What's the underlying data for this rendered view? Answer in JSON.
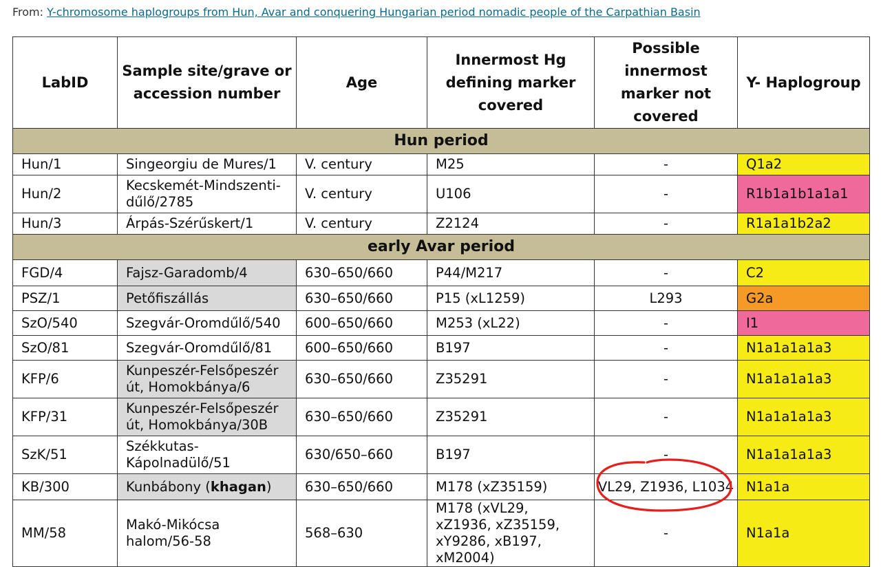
{
  "header": {
    "from_label": "From: ",
    "link_text": "Y-chromosome haplogroups from Hun, Avar and conquering Hungarian period nomadic people of the Carpathian Basin"
  },
  "columns": [
    "LabID",
    "Sample site/grave or accession number",
    "Age",
    "Innermost Hg defining marker covered",
    "Possible innermost marker not covered",
    "Y- Haplogroup"
  ],
  "sections": [
    {
      "title": "Hun period",
      "rows": [
        {
          "labid": "Hun/1",
          "site": "Singeorgiu de Mures/1",
          "age": "V. century",
          "marker": "M25",
          "not_covered": "-",
          "hg": "Q1a2",
          "hg_color": "#f6eb14",
          "site_gray": false
        },
        {
          "labid": "Hun/2",
          "site": "Kecskemét-Mindszenti-dűlő/2785",
          "age": "V. century",
          "marker": "U106",
          "not_covered": "-",
          "hg": "R1b1a1b1a1a1",
          "hg_color": "#ef6a9a",
          "site_gray": false
        },
        {
          "labid": "Hun/3",
          "site": "Árpás-Szérűskert/1",
          "age": "V. century",
          "marker": "Z2124",
          "not_covered": "-",
          "hg": "R1a1a1b2a2",
          "hg_color": "#f6eb14",
          "site_gray": false
        }
      ]
    },
    {
      "title": "early Avar period",
      "rows": [
        {
          "labid": "FGD/4",
          "site": "Fajsz-Garadomb/4",
          "age": "630–650/660",
          "marker": "P44/M217",
          "not_covered": "-",
          "hg": "C2",
          "hg_color": "#f6eb14",
          "site_gray": true
        },
        {
          "labid": "PSZ/1",
          "site": "Petőfiszállás",
          "age": "630–650/660",
          "marker": "P15 (xL1259)",
          "not_covered": "L293",
          "hg": "G2a",
          "hg_color": "#f59a26",
          "site_gray": true
        },
        {
          "labid": "SzO/540",
          "site": "Szegvár-Oromdűlő/540",
          "age": "600–650/660",
          "marker": "M253 (xL22)",
          "not_covered": "-",
          "hg": "I1",
          "hg_color": "#ef6a9a",
          "site_gray": false
        },
        {
          "labid": "SzO/81",
          "site": "Szegvár-Oromdűlő/81",
          "age": "600–650/660",
          "marker": "B197",
          "not_covered": "-",
          "hg": "N1a1a1a1a3",
          "hg_color": "#f6eb14",
          "site_gray": false
        },
        {
          "labid": "KFP/6",
          "site": "Kunpeszér-Felsőpeszér út, Homokbánya/6",
          "age": "630–650/660",
          "marker": "Z35291",
          "not_covered": "-",
          "hg": "N1a1a1a1a3",
          "hg_color": "#f6eb14",
          "site_gray": true
        },
        {
          "labid": "KFP/31",
          "site": "Kunpeszér-Felsőpeszér út, Homokbánya/30B",
          "age": "630–650/660",
          "marker": "Z35291",
          "not_covered": "-",
          "hg": "N1a1a1a1a3",
          "hg_color": "#f6eb14",
          "site_gray": true
        },
        {
          "labid": "SzK/51",
          "site": "Székkutas-Kápolnadülő/51",
          "age": "630/650–660",
          "marker": "B197",
          "not_covered": "-",
          "hg": "N1a1a1a1a3",
          "hg_color": "#f6eb14",
          "site_gray": false
        },
        {
          "labid": "KB/300",
          "site": "Kunbábony (khagan)",
          "site_prefix": "Kunbábony (",
          "site_bold": "khagan",
          "site_suffix": ")",
          "age": "630–650/660",
          "marker": "M178 (xZ35159)",
          "not_covered": "VL29, Z1936, L1034",
          "hg": "N1a1a",
          "hg_color": "#f6eb14",
          "site_gray": true
        },
        {
          "labid": "MM/58",
          "site": "Makó-Mikócsa halom/56-58",
          "age": "568–630",
          "marker": "M178 (xVL29, xZ1936, xZ35159, xY9286, xB197, xM2004)",
          "not_covered": "-",
          "hg": "N1a1a",
          "hg_color": "#f6eb14",
          "site_gray": false
        }
      ]
    }
  ],
  "annotation": {
    "shape": "hand-drawn-ellipse",
    "color": "#e3201b",
    "target": "KB/300 not_covered"
  }
}
